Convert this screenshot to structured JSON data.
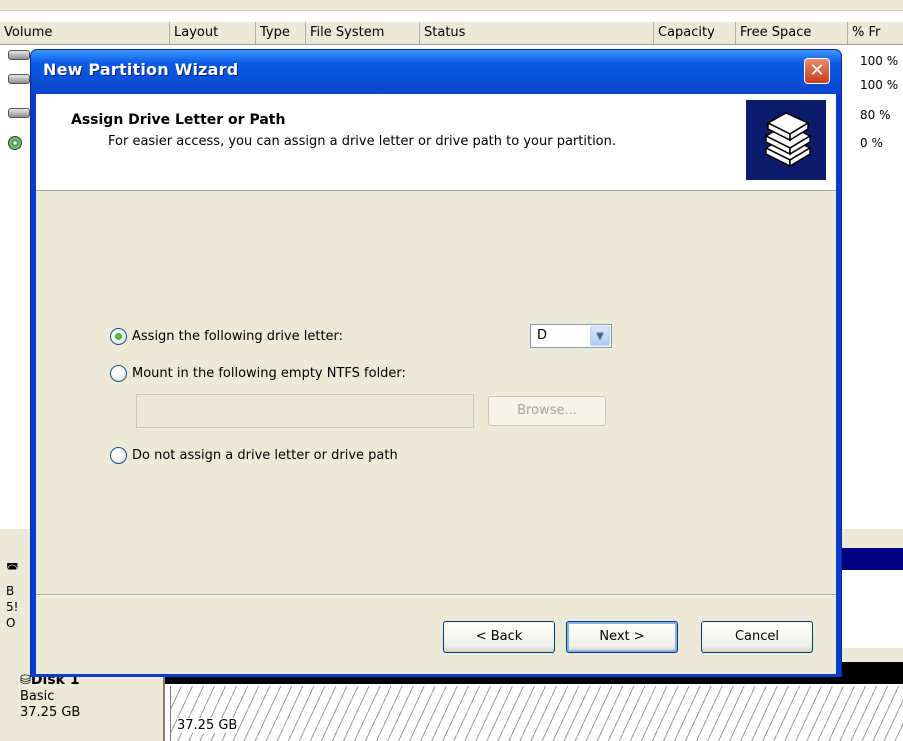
{
  "background": {
    "columns": [
      "Volume",
      "Layout",
      "Type",
      "File System",
      "Status",
      "Capacity",
      "Free Space",
      "% Fr"
    ],
    "free_percent": [
      "100 %",
      "100 %",
      "80 %",
      "0 %"
    ],
    "lower_left_fragments": [
      "B",
      "5!",
      "O"
    ],
    "disk1": {
      "name": "Disk 1",
      "type": "Basic",
      "size": "37.25 GB",
      "partition_size": "37.25 GB"
    }
  },
  "wizard": {
    "title": "New Partition Wizard",
    "header": {
      "title": "Assign Drive Letter or Path",
      "subtitle": "For easier access, you can assign a drive letter or drive path to your partition."
    },
    "options": {
      "assign_letter": "Assign the following drive letter:",
      "mount_folder": "Mount in the following empty NTFS folder:",
      "no_assign": "Do not assign a drive letter or drive path"
    },
    "selected_option": "assign_letter",
    "drive_letter": "D",
    "folder_path": "",
    "browse_label": "Browse...",
    "buttons": {
      "back": "< Back",
      "next": "Next >",
      "cancel": "Cancel"
    }
  },
  "icons": {
    "close": "close-icon",
    "wizard_header": "disk-stack-icon",
    "dropdown": "chevron-down-icon"
  },
  "colors": {
    "titlebar": "#0a5ae6",
    "face": "#ece9d8",
    "close": "#c3411c",
    "radio_dot": "#21a121"
  }
}
